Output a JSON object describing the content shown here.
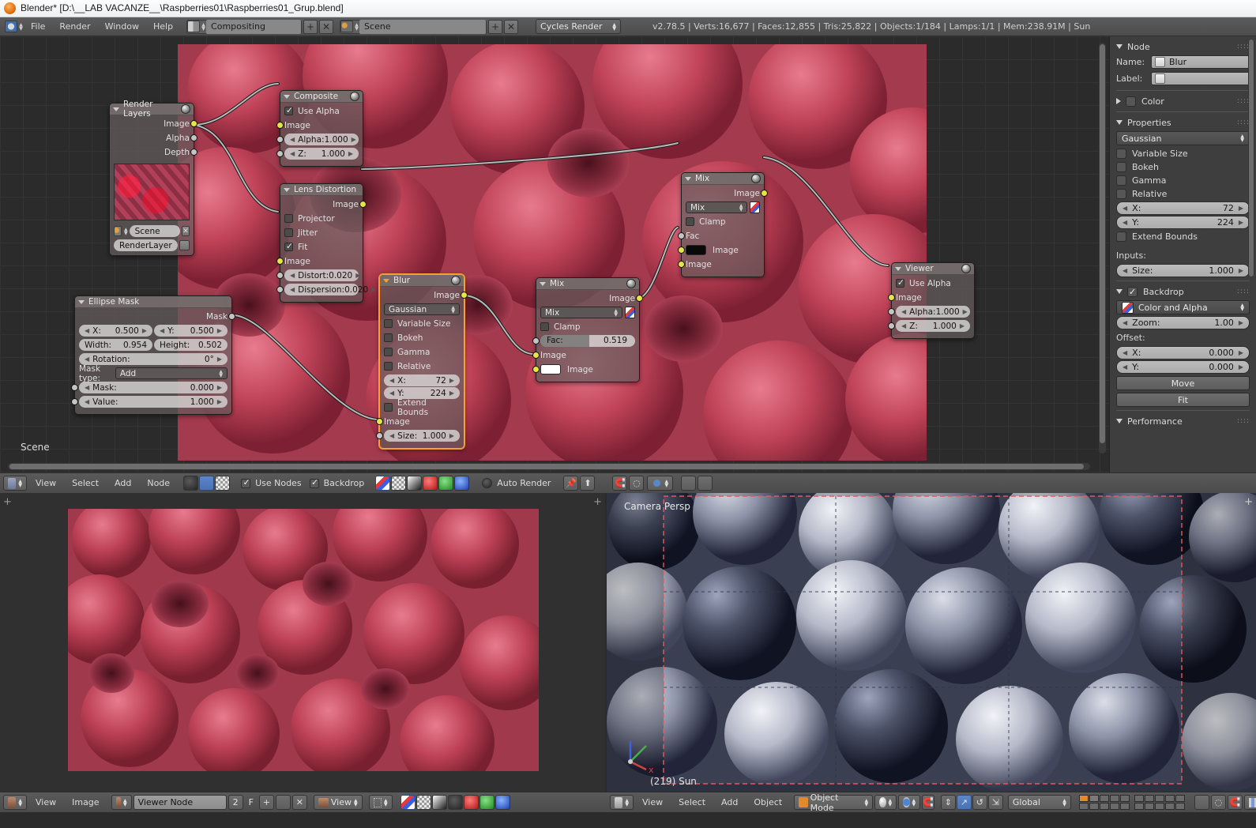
{
  "window": {
    "title": "Blender* [D:\\__LAB VACANZE__\\Raspberries01\\Raspberries01_Grup.blend]",
    "app_icon": "blender-logo-icon"
  },
  "info_header": {
    "editor_icon": "info-editor-icon",
    "menus": [
      "File",
      "Render",
      "Window",
      "Help"
    ],
    "screen_layout": {
      "icon": "screen-layout-icon",
      "value": "Compositing",
      "add_label": "+",
      "delete_label": "✕"
    },
    "scene": {
      "icon": "scene-icon",
      "value": "Scene",
      "add_label": "+",
      "delete_label": "✕"
    },
    "engine": {
      "value": "Cycles Render"
    },
    "stats": "v2.78.5 | Verts:16,677 | Faces:12,855 | Tris:25,822 | Objects:1/184 | Lamps:1/1 | Mem:238.91M | Sun"
  },
  "node_editor": {
    "scene_label": "Scene",
    "header": {
      "editor_icon": "node-editor-icon",
      "menus": [
        "View",
        "Select",
        "Add",
        "Node"
      ],
      "tree_types": [
        "shader-tree-icon",
        "compositor-tree-icon",
        "texture-tree-icon"
      ],
      "use_nodes": {
        "label": "Use Nodes",
        "checked": true
      },
      "backdrop": {
        "label": "Backdrop",
        "checked": true
      },
      "channel_buttons": [
        "color-and-alpha-icon",
        "alpha-icon",
        "z-depth-icon",
        "red-channel-icon",
        "green-channel-icon",
        "blue-channel-icon"
      ],
      "auto_render": {
        "label": "Auto Render",
        "checked": false
      },
      "right_icons": [
        "pin-icon",
        "go-to-parent-icon",
        "snap-icon",
        "proportional-edit-icon",
        "snap-target-icon",
        "copy-icon",
        "paste-icon"
      ]
    },
    "nodes": [
      {
        "name": "Render Layers",
        "type": "input",
        "outputs": [
          "Image",
          "Alpha",
          "Depth"
        ],
        "preview": true,
        "scene_selector": "Scene",
        "layer_selector": "RenderLayer"
      },
      {
        "name": "Composite",
        "use_alpha": {
          "label": "Use Alpha",
          "checked": true
        },
        "inputs": [
          {
            "label": "Image"
          },
          {
            "label": "Alpha:",
            "value": "1.000"
          },
          {
            "label": "Z:",
            "value": "1.000"
          }
        ]
      },
      {
        "name": "Lens Distortion",
        "outputs": [
          "Image"
        ],
        "checks": [
          {
            "label": "Projector",
            "checked": false
          },
          {
            "label": "Jitter",
            "checked": false
          },
          {
            "label": "Fit",
            "checked": true
          }
        ],
        "inputs": [
          {
            "label": "Image"
          },
          {
            "label": "Distort:",
            "value": "0.020"
          },
          {
            "label": "Dispersion:",
            "value": "0.020"
          }
        ]
      },
      {
        "name": "Ellipse Mask",
        "outputs": [
          "Mask"
        ],
        "fields": [
          {
            "label": "X:",
            "value": "0.500"
          },
          {
            "label": "Y:",
            "value": "0.500"
          },
          {
            "label": "Width:",
            "value": "0.954"
          },
          {
            "label": "Height:",
            "value": "0.502"
          },
          {
            "label": "Rotation:",
            "value": "0°"
          }
        ],
        "mask_type": {
          "label": "Mask type:",
          "value": "Add"
        },
        "inputs": [
          {
            "label": "Mask:",
            "value": "0.000"
          },
          {
            "label": "Value:",
            "value": "1.000"
          }
        ]
      },
      {
        "name": "Blur",
        "selected": true,
        "outputs": [
          "Image"
        ],
        "filter_type": "Gaussian",
        "checks": [
          {
            "label": "Variable Size",
            "checked": false
          },
          {
            "label": "Bokeh",
            "checked": false
          },
          {
            "label": "Gamma",
            "checked": false
          },
          {
            "label": "Relative",
            "checked": false
          },
          {
            "label": "Extend Bounds",
            "checked": false
          }
        ],
        "fields": [
          {
            "label": "X:",
            "value": "72"
          },
          {
            "label": "Y:",
            "value": "224"
          }
        ],
        "inputs": [
          {
            "label": "Image"
          },
          {
            "label": "Size:",
            "value": "1.000"
          }
        ]
      },
      {
        "name": "Mix",
        "id": "mix-lower",
        "outputs": [
          "Image"
        ],
        "blend_mode": "Mix",
        "clamp": {
          "label": "Clamp",
          "checked": false
        },
        "fac": {
          "label": "Fac:",
          "value": "0.519",
          "fill_pct": 52
        },
        "inputs": [
          {
            "label": "Image"
          },
          {
            "label": "Image",
            "swatch": "#ffffff"
          }
        ]
      },
      {
        "name": "Mix",
        "id": "mix-upper",
        "outputs": [
          "Image"
        ],
        "blend_mode": "Mix",
        "clamp": {
          "label": "Clamp",
          "checked": false
        },
        "fac_label": "Fac",
        "inputs": [
          {
            "label": "Image",
            "swatch": "#000000"
          },
          {
            "label": "Image"
          }
        ]
      },
      {
        "name": "Viewer",
        "use_alpha": {
          "label": "Use Alpha",
          "checked": true
        },
        "inputs": [
          {
            "label": "Image"
          },
          {
            "label": "Alpha:",
            "value": "1.000"
          },
          {
            "label": "Z:",
            "value": "1.000"
          }
        ]
      }
    ]
  },
  "properties_sidebar": {
    "node_panel": {
      "title": "Node",
      "name_label": "Name:",
      "name_value": "Blur",
      "label_label": "Label:",
      "label_value": ""
    },
    "color_panel": {
      "title": "Color",
      "collapsed": true
    },
    "properties_panel": {
      "title": "Properties",
      "filter_type": "Gaussian",
      "checks": [
        {
          "label": "Variable Size",
          "checked": false
        },
        {
          "label": "Bokeh",
          "checked": false
        },
        {
          "label": "Gamma",
          "checked": false
        },
        {
          "label": "Relative",
          "checked": false
        }
      ],
      "fields": [
        {
          "label": "X:",
          "value": "72"
        },
        {
          "label": "Y:",
          "value": "224"
        }
      ],
      "extend_bounds": {
        "label": "Extend Bounds",
        "checked": false
      },
      "inputs_label": "Inputs:",
      "size": {
        "label": "Size:",
        "value": "1.000"
      }
    },
    "backdrop_panel": {
      "title": "Backdrop",
      "enabled": true,
      "channel": "Color and Alpha",
      "zoom": {
        "label": "Zoom:",
        "value": "1.00"
      },
      "offset_label": "Offset:",
      "offset_x": {
        "label": "X:",
        "value": "0.000"
      },
      "offset_y": {
        "label": "Y:",
        "value": "0.000"
      },
      "move_button": "Move",
      "fit_button": "Fit"
    },
    "performance_panel": {
      "title": "Performance"
    }
  },
  "image_editor": {
    "header": {
      "editor_icon": "image-editor-icon",
      "menus": [
        "View",
        "Image"
      ],
      "image_selector": {
        "icon": "image-data-icon",
        "value": "Viewer Node",
        "users": "2",
        "fake_user": "F",
        "new": "+",
        "open": "open-image-icon",
        "unlink": "✕"
      },
      "view_selector": {
        "icon": "image-data-icon",
        "value": "View"
      },
      "pivot_icon": "pivot-icon",
      "channel_buttons": [
        "color-and-alpha-icon",
        "alpha-icon",
        "z-depth-icon",
        "render-result-icon",
        "red-channel-icon",
        "green-channel-icon",
        "blue-channel-icon"
      ]
    }
  },
  "viewport_3d": {
    "view_label": "Camera Persp",
    "object_label": "(219) Sun",
    "header": {
      "editor_icon": "3d-view-icon",
      "menus": [
        "View",
        "Select",
        "Add",
        "Object"
      ],
      "mode": {
        "icon": "object-mode-icon",
        "value": "Object Mode"
      },
      "shading_icon": "solid-shading-icon",
      "pivot_icon": "pivot-median-icon",
      "snap_icon": "snap-magnet-icon",
      "manipulator_icons": [
        "translate-manipulator-icon",
        "rotate-manipulator-icon",
        "scale-manipulator-icon"
      ],
      "transform_orientation": "Global",
      "layers_label": "scene-layers-grid",
      "right_icons": [
        "render-shading-icon",
        "proportional-edit-icon",
        "snap-icon",
        "axis-lock-icon",
        "viewport-render-icon",
        "new-scene-icon"
      ]
    }
  },
  "colors": {
    "accent_orange": "#ff9d2f",
    "socket_image": "#e5e54a",
    "socket_value": "#c4c4c4",
    "backdrop_tint": "#9e3546",
    "header_bg": "#4c4c4c"
  }
}
